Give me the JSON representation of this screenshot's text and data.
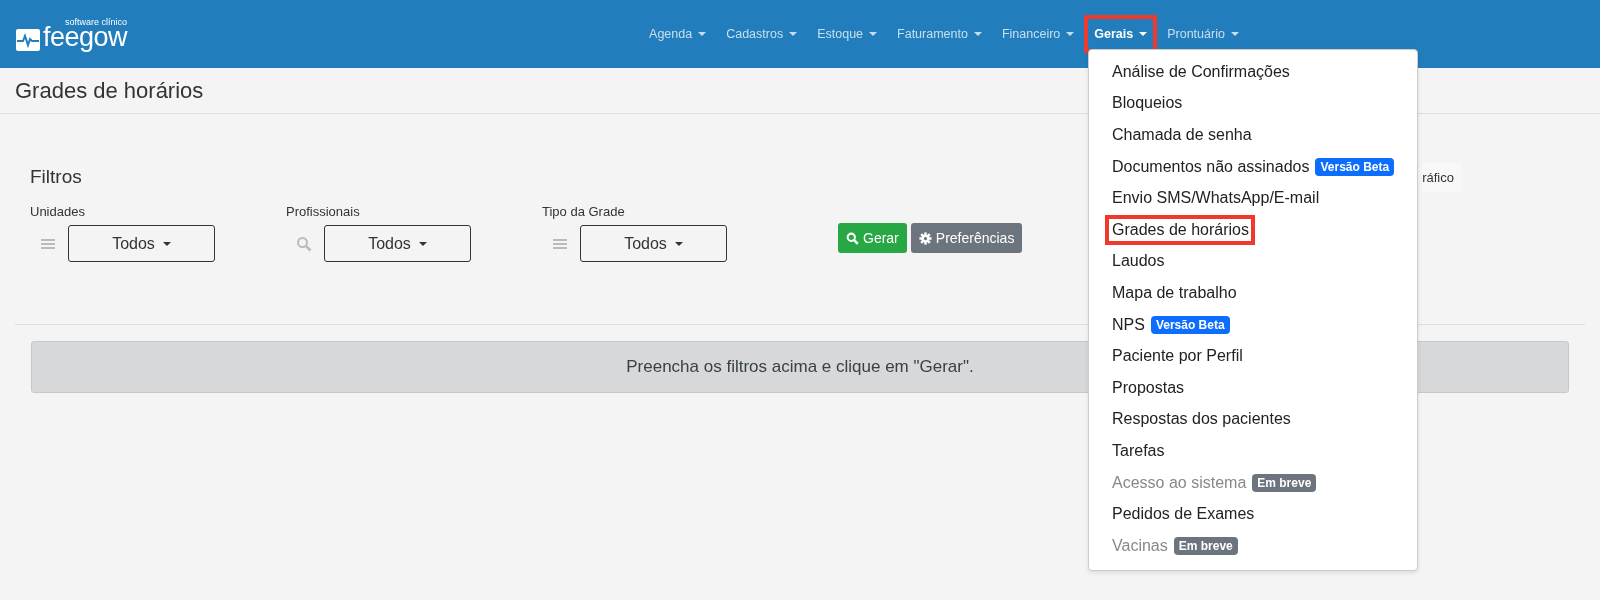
{
  "logo": {
    "tagline": "software clínico",
    "name": "feegow"
  },
  "nav": [
    {
      "label": "Agenda",
      "selected": false,
      "highlighted": false
    },
    {
      "label": "Cadastros",
      "selected": false,
      "highlighted": false
    },
    {
      "label": "Estoque",
      "selected": false,
      "highlighted": false
    },
    {
      "label": "Faturamento",
      "selected": false,
      "highlighted": false
    },
    {
      "label": "Financeiro",
      "selected": false,
      "highlighted": false
    },
    {
      "label": "Gerais",
      "selected": true,
      "highlighted": true
    },
    {
      "label": "Prontuário",
      "selected": false,
      "highlighted": false
    }
  ],
  "page_title": "Grades de horários",
  "filters": {
    "title": "Filtros",
    "partial_button": "ráfico",
    "fields": [
      {
        "label": "Unidades",
        "kind": "list",
        "value": "Todos"
      },
      {
        "label": "Profissionais",
        "kind": "search",
        "value": "Todos"
      },
      {
        "label": "Tipo da Grade",
        "kind": "list",
        "value": "Todos"
      }
    ],
    "buttons": [
      {
        "label": "Gerar",
        "kind": "primary"
      },
      {
        "label": "Preferências",
        "kind": "secondary"
      }
    ]
  },
  "alert": "Preencha os filtros acima e clique em \"Gerar\".",
  "dropdown": [
    {
      "label": "Análise de Confirmações",
      "disabled": false,
      "highlighted": false
    },
    {
      "label": "Bloqueios",
      "disabled": false,
      "highlighted": false
    },
    {
      "label": "Chamada de senha",
      "disabled": false,
      "highlighted": false
    },
    {
      "label": "Documentos não assinados",
      "disabled": false,
      "highlighted": false,
      "badge": {
        "text": "Versão Beta",
        "kind": "beta"
      }
    },
    {
      "label": "Envio SMS/WhatsApp/E-mail",
      "disabled": false,
      "highlighted": false
    },
    {
      "label": "Grades de horários",
      "disabled": false,
      "highlighted": true
    },
    {
      "label": "Laudos",
      "disabled": false,
      "highlighted": false
    },
    {
      "label": "Mapa de trabalho",
      "disabled": false,
      "highlighted": false
    },
    {
      "label": "NPS",
      "disabled": false,
      "highlighted": false,
      "badge": {
        "text": "Versão Beta",
        "kind": "beta"
      }
    },
    {
      "label": "Paciente por Perfil",
      "disabled": false,
      "highlighted": false
    },
    {
      "label": "Propostas",
      "disabled": false,
      "highlighted": false
    },
    {
      "label": "Respostas dos pacientes",
      "disabled": false,
      "highlighted": false
    },
    {
      "label": "Tarefas",
      "disabled": false,
      "highlighted": false
    },
    {
      "label": "Acesso ao sistema",
      "disabled": true,
      "highlighted": false,
      "badge": {
        "text": "Em breve",
        "kind": "soon"
      }
    },
    {
      "label": "Pedidos de Exames",
      "disabled": false,
      "highlighted": false
    },
    {
      "label": "Vacinas",
      "disabled": true,
      "highlighted": false,
      "badge": {
        "text": "Em breve",
        "kind": "soon"
      }
    }
  ]
}
